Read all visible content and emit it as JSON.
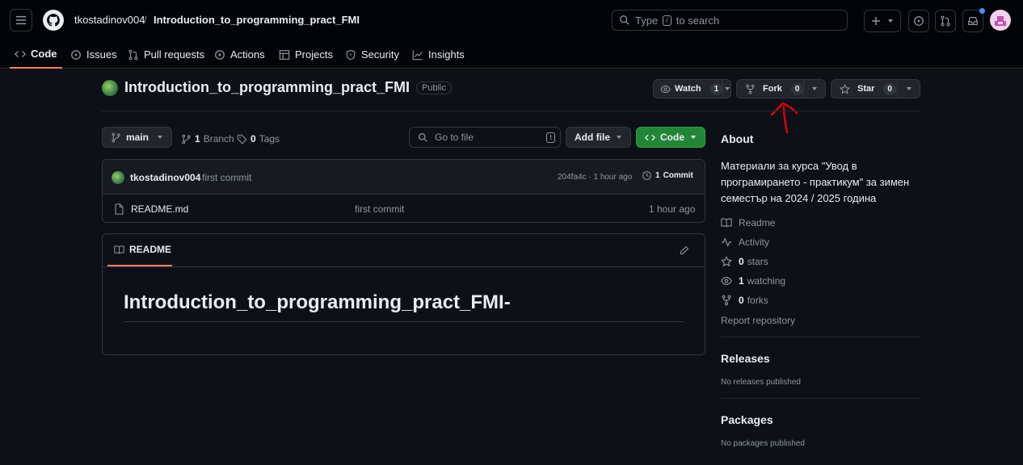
{
  "header": {
    "owner": "tkostadinov004",
    "separator": "/",
    "repo": "Introduction_to_programming_pract_FMI",
    "search_prefix": "Type",
    "search_key": "/",
    "search_suffix": "to search"
  },
  "nav": {
    "tabs": [
      {
        "label": "Code"
      },
      {
        "label": "Issues"
      },
      {
        "label": "Pull requests"
      },
      {
        "label": "Actions"
      },
      {
        "label": "Projects"
      },
      {
        "label": "Security"
      },
      {
        "label": "Insights"
      }
    ]
  },
  "repo": {
    "name": "Introduction_to_programming_pract_FMI",
    "visibility": "Public",
    "watch_label": "Watch",
    "watch_count": "1",
    "fork_label": "Fork",
    "fork_count": "0",
    "star_label": "Star",
    "star_count": "0"
  },
  "toolbar": {
    "branch": "main",
    "branches_count": "1",
    "branches_label": "Branch",
    "tags_count": "0",
    "tags_label": "Tags",
    "goto_placeholder": "Go to file",
    "goto_key": "t",
    "add_file_label": "Add file",
    "code_label": "Code"
  },
  "commit": {
    "author": "tkostadinov004",
    "message": "first commit",
    "hash_time": "204fa4c · 1 hour ago",
    "commits_count": "1",
    "commits_label": "Commit"
  },
  "files": [
    {
      "name": "README.md",
      "message": "first commit",
      "time": "1 hour ago"
    }
  ],
  "readme": {
    "tab_label": "README",
    "heading": "Introduction_to_programming_pract_FMI-"
  },
  "about": {
    "heading": "About",
    "description": "Материали за курса \"Увод в програмирането - практикум\" за зимен семестър на 2024 / 2025 година",
    "readme": "Readme",
    "activity": "Activity",
    "stars_count": "0",
    "stars_label": "stars",
    "watching_count": "1",
    "watching_label": "watching",
    "forks_count": "0",
    "forks_label": "forks",
    "report": "Report repository"
  },
  "releases": {
    "heading": "Releases",
    "empty": "No releases published"
  },
  "packages": {
    "heading": "Packages",
    "empty": "No packages published"
  },
  "colors": {
    "accent_underline": "#f78166",
    "code_button": "#238636",
    "annotation": "#e0000f"
  }
}
